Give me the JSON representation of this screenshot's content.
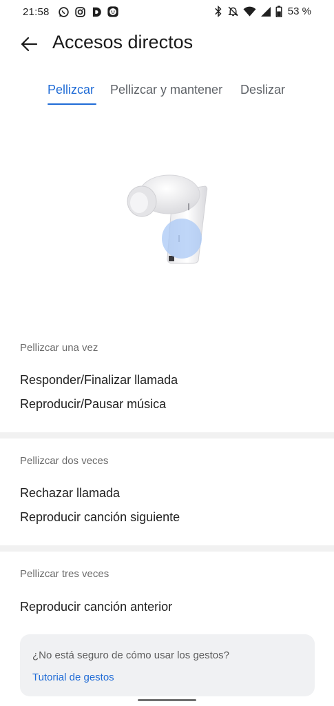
{
  "status_bar": {
    "time": "21:58",
    "battery": "53 %",
    "left_icons": [
      "whatsapp-icon",
      "instagram-icon",
      "d-app-icon",
      "face-app-icon"
    ],
    "right_icons": [
      "bluetooth-icon",
      "notifications-off-icon",
      "wifi-icon",
      "cell-signal-icon",
      "battery-icon"
    ]
  },
  "header": {
    "title": "Accesos directos",
    "back_icon": "arrow-back-icon"
  },
  "tabs": [
    {
      "label": "Pellizcar",
      "active": true
    },
    {
      "label": "Pellizcar y mantener",
      "active": false
    },
    {
      "label": "Deslizar",
      "active": false
    }
  ],
  "illustration": {
    "icon": "earbud-illustration",
    "highlight_color": "#a9c8f5"
  },
  "sections": [
    {
      "header": "Pellizcar una vez",
      "items": [
        "Responder/Finalizar llamada",
        "Reproducir/Pausar música"
      ]
    },
    {
      "header": "Pellizcar dos veces",
      "items": [
        "Rechazar llamada",
        "Reproducir canción siguiente"
      ]
    },
    {
      "header": "Pellizcar tres veces",
      "items": [
        "Reproducir canción anterior"
      ]
    }
  ],
  "help_card": {
    "question": "¿No está seguro de cómo usar los gestos?",
    "link": "Tutorial de gestos"
  },
  "colors": {
    "accent": "#1f6bd6",
    "divider": "#f1f1f1",
    "card_bg": "#f0f1f3"
  }
}
